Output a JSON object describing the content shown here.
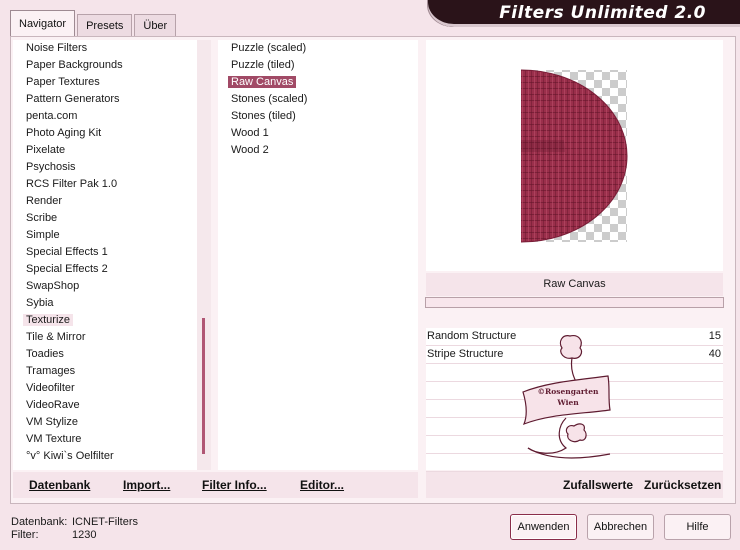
{
  "app": {
    "title": "Filters Unlimited 2.0"
  },
  "tabs": [
    {
      "label": "Navigator"
    },
    {
      "label": "Presets"
    },
    {
      "label": "Über"
    }
  ],
  "categories": [
    "Noise Filters",
    "Paper Backgrounds",
    "Paper Textures",
    "Pattern Generators",
    "penta.com",
    "Photo Aging Kit",
    "Pixelate",
    "Psychosis",
    "RCS Filter Pak 1.0",
    "Render",
    "Scribe",
    "Simple",
    "Special Effects 1",
    "Special Effects 2",
    "SwapShop",
    "Sybia",
    "Texturize",
    "Tile & Mirror",
    "Toadies",
    "Tramages",
    "Videofilter",
    "VideoRave",
    "VM Stylize",
    "VM Texture",
    "°v° Kiwi`s Oelfilter"
  ],
  "selected_category": "Texturize",
  "filters": [
    "Puzzle (scaled)",
    "Puzzle (tiled)",
    "Raw Canvas",
    "Stones (scaled)",
    "Stones (tiled)",
    "Wood 1",
    "Wood 2"
  ],
  "selected_filter": "Raw Canvas",
  "preview": {
    "filter_name": "Raw Canvas",
    "watermark_text": [
      "©Rosengarten",
      "Wien"
    ]
  },
  "params": [
    {
      "name": "Random Structure",
      "value": "15"
    },
    {
      "name": "Stripe Structure",
      "value": "40"
    }
  ],
  "toolbar": {
    "database": "Datenbank",
    "import": "Import...",
    "filter_info": "Filter Info...",
    "editor": "Editor...",
    "randomize": "Zufallswerte",
    "reset": "Zurücksetzen"
  },
  "status": {
    "database_label": "Datenbank:",
    "database_value": "ICNET-Filters",
    "filter_label": "Filter:",
    "filter_value": "1230"
  },
  "buttons": {
    "apply": "Anwenden",
    "cancel": "Abbrechen",
    "help": "Hilfe"
  },
  "colors": {
    "accent": "#a14a66",
    "background": "#f5e4ea",
    "banner": "#2a1319",
    "preview_fill": "#8e2a45"
  }
}
